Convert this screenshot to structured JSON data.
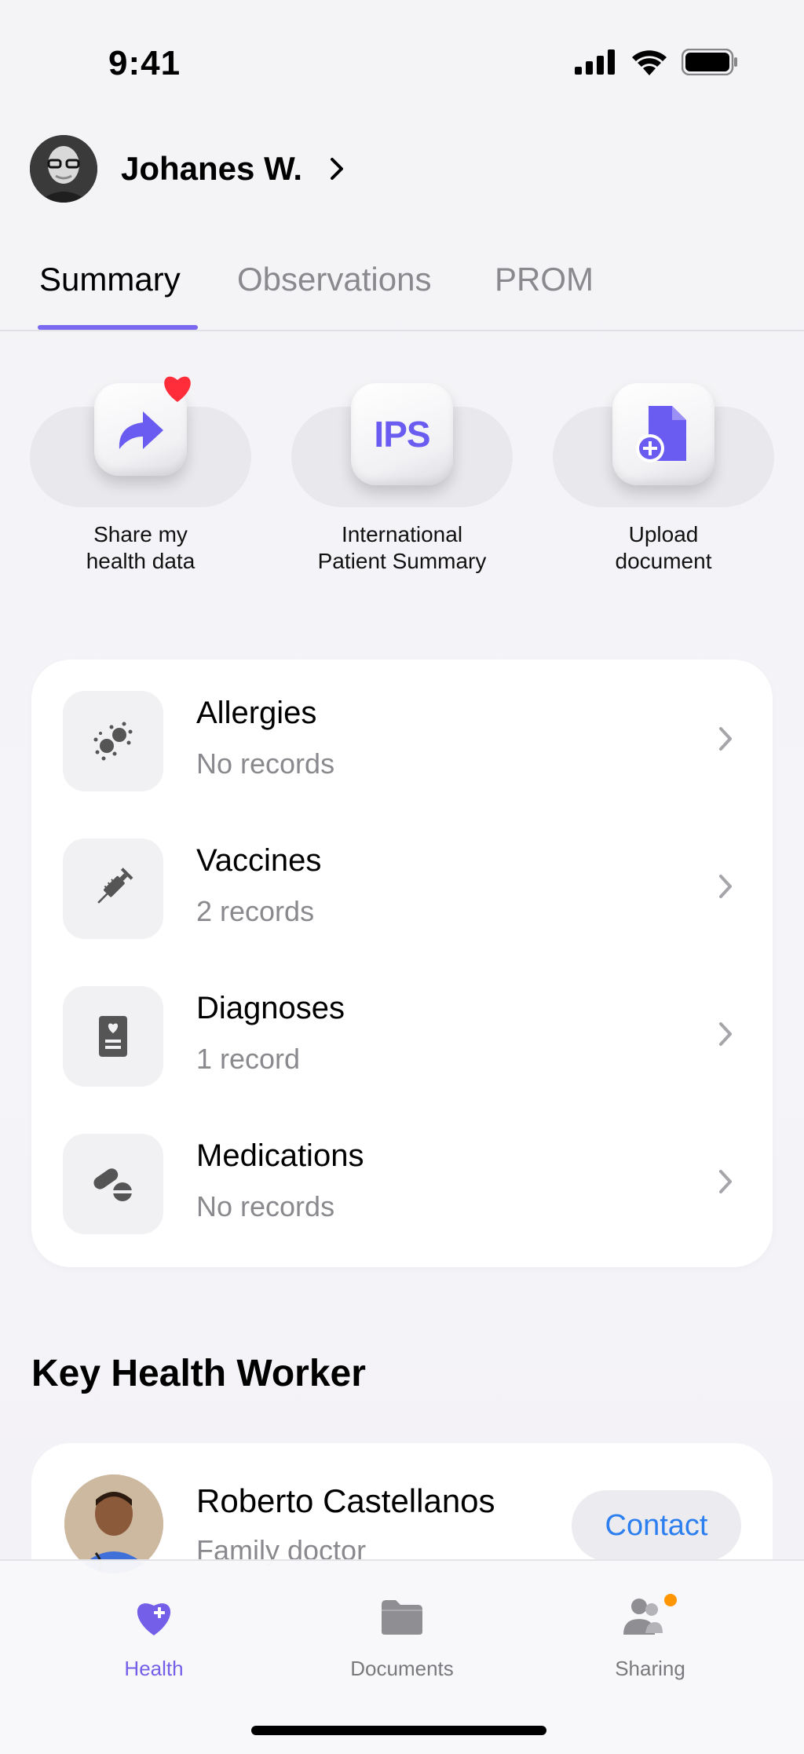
{
  "status": {
    "time": "9:41"
  },
  "profile": {
    "name": "Johanes W."
  },
  "tabs": [
    {
      "label": "Summary",
      "active": true
    },
    {
      "label": "Observations",
      "active": false
    },
    {
      "label": "PROM",
      "active": false
    }
  ],
  "actions": [
    {
      "label": "Share my\nhealth data",
      "icon": "share-heart-icon"
    },
    {
      "label": "International\nPatient Summary",
      "icon": "ips-icon",
      "icon_text": "IPS"
    },
    {
      "label": "Upload\ndocument",
      "icon": "upload-document-icon"
    }
  ],
  "records": [
    {
      "title": "Allergies",
      "subtitle": "No records",
      "icon": "allergy-icon"
    },
    {
      "title": "Vaccines",
      "subtitle": "2 records",
      "icon": "syringe-icon"
    },
    {
      "title": "Diagnoses",
      "subtitle": "1 record",
      "icon": "diagnosis-icon"
    },
    {
      "title": "Medications",
      "subtitle": "No records",
      "icon": "pills-icon"
    }
  ],
  "key_worker": {
    "section_title": "Key Health Worker",
    "name": "Roberto Castellanos",
    "role": "Family doctor",
    "contact_label": "Contact"
  },
  "tabbar": [
    {
      "label": "Health",
      "icon": "heart-plus-icon",
      "active": true
    },
    {
      "label": "Documents",
      "icon": "folder-icon",
      "active": false
    },
    {
      "label": "Sharing",
      "icon": "people-icon",
      "active": false
    }
  ],
  "colors": {
    "accent": "#7460e8",
    "link": "#2d7ff0",
    "badge": "#ff9500",
    "heart": "#ff2d3a"
  }
}
